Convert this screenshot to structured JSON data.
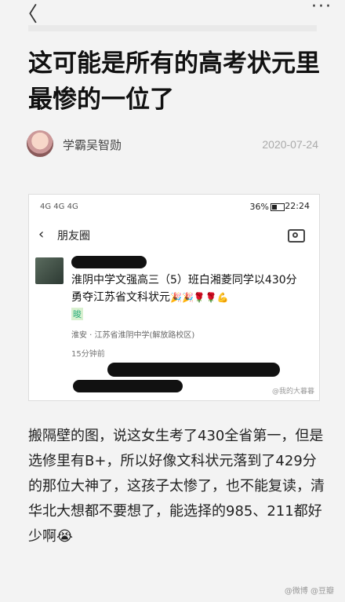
{
  "topbar": {
    "back_icon": "chevron-left-icon",
    "more_icon": "more-dots-icon"
  },
  "article": {
    "title": "这可能是所有的高考状元里最惨的一位了",
    "author": "学霸吴智勋",
    "date": "2020-07-24"
  },
  "screenshot": {
    "status": {
      "signal": "4G 4G 4G",
      "battery": "36%",
      "time": "22:24"
    },
    "moments_title": "朋友圈",
    "post_text": "淮阴中学文强高三（5）班白湘菱同学以430分勇夺江苏省文科状元",
    "post_emojis": "🎉🎉🌹🌹💪",
    "tag_icon": "晙",
    "location": "淮安 · 江苏省淮阴中学(解放路校区)",
    "time_ago": "15分钟前",
    "watermark": "@我的大暮暮"
  },
  "body": "搬隔壁的图，说这女生考了430全省第一，但是选修里有B+，所以好像文科状元落到了429分的那位大神了，这孩子太惨了，也不能复读，清华北大想都不要想了，能选择的985、211都好少啊😭",
  "footer": {
    "watermark": "@微博 @豆瓣"
  }
}
